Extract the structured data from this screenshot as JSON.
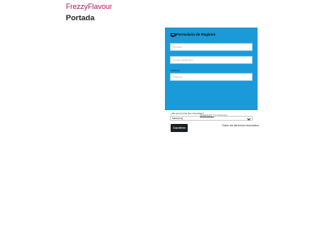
{
  "site": {
    "title": "FrezzyFlavour"
  },
  "page": {
    "title": "Portada"
  },
  "form": {
    "heading": "Formulario de Registro",
    "fields": [
      {
        "placeholder": "Nombre"
      },
      {
        "placeholder": "Correo electronico"
      }
    ],
    "phone": {
      "label": "Telefono",
      "placeholder": "Telefono"
    },
    "source": {
      "label": "¿De que forma nos conociste?",
      "selected": "Marketing"
    },
    "submit_label": "Suscribirse",
    "powered_link": "Contact Form 7",
    "powered_text": " by Shortcodes"
  },
  "footer": {
    "text": "Todos los derechos reservados"
  },
  "colors": {
    "brand": "#b8145a",
    "form_bg": "#1a9ad9",
    "button_bg": "#1c1f24"
  }
}
